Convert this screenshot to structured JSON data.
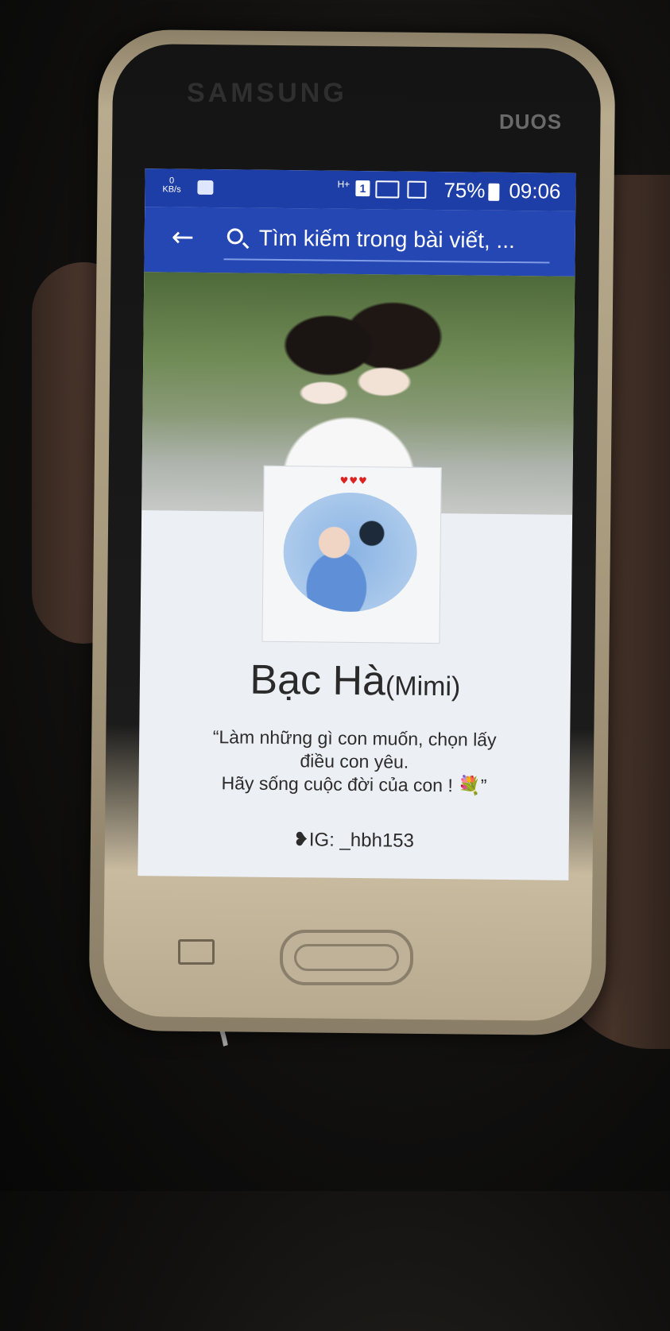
{
  "device": {
    "brand": "SAMSUNG",
    "model_badge": "DUOS"
  },
  "status_bar": {
    "data_rate_value": "0",
    "data_rate_unit": "KB/s",
    "network_type": "H+",
    "sim_slot": "1",
    "battery_percent": "75%",
    "time": "09:06"
  },
  "search": {
    "placeholder": "Tìm kiếm trong bài viết, ..."
  },
  "profile": {
    "name": "Bạc Hà",
    "nickname": "(Mimi)",
    "hearts": "♥♥♥",
    "bio_lines": [
      "“Làm những gì con muốn, chọn lấy",
      "điều con yêu.",
      "Hãy sống cuộc đời của con ! 💐”"
    ],
    "instagram": "❥IG: _hbh153"
  }
}
